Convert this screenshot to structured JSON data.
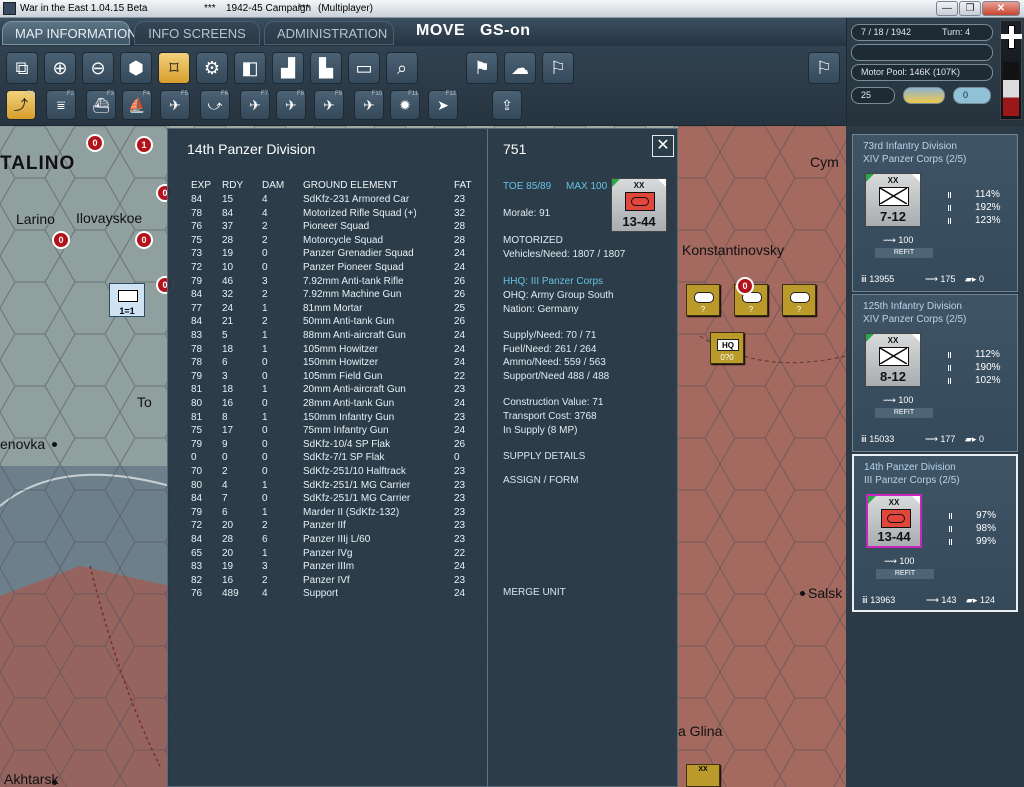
{
  "window": {
    "title_app": "War in the East 1.04.15 Beta",
    "title_sep1": "***",
    "title_campaign": "1942-45 Campaign",
    "title_sep2": "***",
    "title_mode": "(Multiplayer)",
    "btn_minimize": "—",
    "btn_restore": "❐",
    "btn_close": "✕"
  },
  "menu": {
    "tabs": [
      "MAP INFORMATION",
      "INFO SCREENS",
      "ADMINISTRATION"
    ],
    "mode": "MOVE",
    "gs": "GS-on"
  },
  "toolbar": {
    "row1_icons": [
      "unit-display-icon",
      "zoom-in-icon",
      "zoom-out-icon",
      "hex-display-icon",
      "unit-select-icon",
      "settings-icon",
      "unit-stack-icon",
      "air-unit-icon",
      "factory-icon",
      "blank-box-icon",
      "zoom-hex-icon",
      "flag-right-icon",
      "weather-icon",
      "pennant-icon",
      "surrender-flag-icon"
    ],
    "row2_fkeys": [
      "F1",
      "F2",
      "F3",
      "F4",
      "F5",
      "F6",
      "F7",
      "F8",
      "F9",
      "F10",
      "F11",
      "F12"
    ],
    "row2_icons": [
      "ground-move-icon",
      "rail-icon",
      "naval-icon",
      "naval-transport-icon",
      "air-recon-icon",
      "air-transfer-icon",
      "air-strike-icon",
      "air-supply-icon",
      "paradrop-icon",
      "interdiction-icon",
      "explosion-icon",
      "air-mission-icon",
      "upload-icon"
    ]
  },
  "status": {
    "date": "7 / 18 / 1942",
    "turn": "Turn: 4",
    "motor_pool": "Motor Pool:  146K (107K)",
    "counter_left": "25",
    "counter_right": "0"
  },
  "map": {
    "labels": {
      "talino": "TALINO",
      "larino": "Larino",
      "ilovayskoe": "Ilovayskoe",
      "enovka": "enovka",
      "to": "To",
      "akhtarsk": "Akhtarsk",
      "konstantinovsky": "Konstantinovsky",
      "cym": "Cym",
      "salsk": "Salsk",
      "glina": "a Glina"
    },
    "soviet_markers": [
      "0",
      "1",
      "0",
      "0",
      "0",
      "0"
    ],
    "own_unit_strength": "1=1",
    "enemy_marker_count": "0",
    "enemy_q": "?",
    "hq_label": "HQ",
    "hq_strength": "0?0",
    "corner_xx": "XX"
  },
  "detail": {
    "title": "14th Panzer Division",
    "unit_id": "751",
    "close": "✕",
    "headers": {
      "exp": "EXP",
      "rdy": "RDY",
      "dam": "DAM",
      "element": "GROUND ELEMENT",
      "fat": "FAT"
    },
    "rows": [
      {
        "exp": "84",
        "rdy": "15",
        "dam": "4",
        "el": "SdKfz-231 Armored Car",
        "fat": "23"
      },
      {
        "exp": "78",
        "rdy": "84",
        "dam": "4",
        "el": "Motorized Rifle Squad (+)",
        "fat": "32"
      },
      {
        "exp": "76",
        "rdy": "37",
        "dam": "2",
        "el": "Pioneer Squad",
        "fat": "28"
      },
      {
        "exp": "75",
        "rdy": "28",
        "dam": "2",
        "el": "Motorcycle Squad",
        "fat": "28"
      },
      {
        "exp": "73",
        "rdy": "19",
        "dam": "0",
        "el": "Panzer Grenadier Squad",
        "fat": "24"
      },
      {
        "exp": "72",
        "rdy": "10",
        "dam": "0",
        "el": "Panzer Pioneer Squad",
        "fat": "24"
      },
      {
        "exp": "79",
        "rdy": "46",
        "dam": "3",
        "el": "7.92mm Anti-tank Rifle",
        "fat": "26"
      },
      {
        "exp": "84",
        "rdy": "32",
        "dam": "2",
        "el": "7.92mm Machine Gun",
        "fat": "26"
      },
      {
        "exp": "77",
        "rdy": "24",
        "dam": "1",
        "el": "81mm Mortar",
        "fat": "25"
      },
      {
        "exp": "84",
        "rdy": "21",
        "dam": "2",
        "el": "50mm Anti-tank Gun",
        "fat": "26"
      },
      {
        "exp": "83",
        "rdy": "5",
        "dam": "1",
        "el": "88mm Anti-aircraft Gun",
        "fat": "24"
      },
      {
        "exp": "78",
        "rdy": "18",
        "dam": "1",
        "el": "105mm Howitzer",
        "fat": "24"
      },
      {
        "exp": "78",
        "rdy": "6",
        "dam": "0",
        "el": "150mm Howitzer",
        "fat": "24"
      },
      {
        "exp": "79",
        "rdy": "3",
        "dam": "0",
        "el": "105mm Field Gun",
        "fat": "22"
      },
      {
        "exp": "81",
        "rdy": "18",
        "dam": "1",
        "el": "20mm Anti-aircraft Gun",
        "fat": "23"
      },
      {
        "exp": "80",
        "rdy": "16",
        "dam": "0",
        "el": "28mm Anti-tank Gun",
        "fat": "24"
      },
      {
        "exp": "81",
        "rdy": "8",
        "dam": "1",
        "el": "150mm Infantry Gun",
        "fat": "23"
      },
      {
        "exp": "75",
        "rdy": "17",
        "dam": "0",
        "el": "75mm Infantry Gun",
        "fat": "24"
      },
      {
        "exp": "79",
        "rdy": "9",
        "dam": "0",
        "el": "SdKfz-10/4 SP Flak",
        "fat": "26"
      },
      {
        "exp": "0",
        "rdy": "0",
        "dam": "0",
        "el": "SdKfz-7/1 SP Flak",
        "fat": "0"
      },
      {
        "exp": "70",
        "rdy": "2",
        "dam": "0",
        "el": "SdKfz-251/10 Halftrack",
        "fat": "23"
      },
      {
        "exp": "80",
        "rdy": "4",
        "dam": "1",
        "el": "SdKfz-251/1 MG Carrier",
        "fat": "23"
      },
      {
        "exp": "84",
        "rdy": "7",
        "dam": "0",
        "el": "SdKfz-251/1 MG Carrier",
        "fat": "23"
      },
      {
        "exp": "79",
        "rdy": "6",
        "dam": "1",
        "el": "Marder II (SdKfz-132)",
        "fat": "23"
      },
      {
        "exp": "72",
        "rdy": "20",
        "dam": "2",
        "el": "Panzer IIf",
        "fat": "23"
      },
      {
        "exp": "84",
        "rdy": "28",
        "dam": "6",
        "el": "Panzer IIIj L/60",
        "fat": "23"
      },
      {
        "exp": "65",
        "rdy": "20",
        "dam": "1",
        "el": "Panzer IVg",
        "fat": "22"
      },
      {
        "exp": "83",
        "rdy": "19",
        "dam": "3",
        "el": "Panzer IIIm",
        "fat": "24"
      },
      {
        "exp": "82",
        "rdy": "16",
        "dam": "2",
        "el": "Panzer IVf",
        "fat": "23"
      },
      {
        "exp": "76",
        "rdy": "489",
        "dam": "4",
        "el": "Support",
        "fat": "24"
      }
    ],
    "info": {
      "toe": "TOE 85/89",
      "max": "MAX 100",
      "morale": "Morale:   91",
      "motorized": "MOTORIZED",
      "vehicles": "Vehicles/Need:   1807 / 1807",
      "hhq": "HHQ: III Panzer Corps",
      "ohq": "OHQ: Army Group South",
      "nation": "Nation:   Germany",
      "supply": "Supply/Need:   70 / 71",
      "fuel": "Fuel/Need:          261 / 264",
      "ammo": "Ammo/Need:     559 / 563",
      "support": "Support/Need     488 / 488",
      "construction": "Construction Value:  71",
      "transport": "Transport Cost:       3768",
      "in_supply": "In Supply (8 MP)",
      "supply_details": "SUPPLY DETAILS",
      "assign_form": "ASSIGN / FORM",
      "merge_unit": "MERGE UNIT"
    },
    "counter": {
      "xx": "XX",
      "strength": "13-44"
    }
  },
  "sidebar": {
    "cards": [
      {
        "name": "73rd Infantry Division",
        "corps": "XIV Panzer Corps (2/5)",
        "xx": "XX",
        "strength": "7-12",
        "p1": "114%",
        "p2": "192%",
        "p3": "123%",
        "mp": "100",
        "refit": "REFIT",
        "men": "13955",
        "air": "175",
        "tanks": "0"
      },
      {
        "name": "125th Infantry Division",
        "corps": "XIV Panzer Corps (2/5)",
        "xx": "XX",
        "strength": "8-12",
        "p1": "112%",
        "p2": "190%",
        "p3": "102%",
        "mp": "100",
        "refit": "REFIT",
        "men": "15033",
        "air": "177",
        "tanks": "0"
      },
      {
        "name": "14th Panzer Division",
        "corps": "III Panzer Corps (2/5)",
        "xx": "XX",
        "strength": "13-44",
        "p1": "97%",
        "p2": "98%",
        "p3": "99%",
        "mp": "100",
        "refit": "REFIT",
        "men": "13963",
        "air": "143",
        "tanks": "124"
      }
    ]
  },
  "colors": {
    "panel": "#263845",
    "accent": "#67c0e4",
    "soviet_red": "#b3121a",
    "german_armor": "#e0463a",
    "selected_border": "#c824c0"
  }
}
